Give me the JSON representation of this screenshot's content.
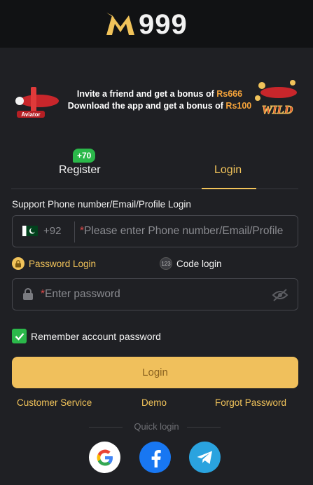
{
  "brand": {
    "logo_text": "999"
  },
  "promo": {
    "line1_prefix": "Invite a friend and get a bonus of ",
    "line1_amount": "Rs666",
    "line2_prefix": "Download the app and get a bonus of ",
    "line2_amount": "Rs100"
  },
  "tabs": {
    "register": "Register",
    "register_badge": "+70",
    "login": "Login",
    "active": "login"
  },
  "form": {
    "support_label": "Support Phone number/Email/Profile Login",
    "country_code": "+92",
    "phone_placeholder": "Please enter Phone number/Email/Profile",
    "password_login": "Password Login",
    "code_login": "Code login",
    "code_icon": "123",
    "password_placeholder": "Enter password",
    "required_mark": "*",
    "remember_label": "Remember account password",
    "remember_checked": true,
    "login_button": "Login"
  },
  "links": {
    "customer_service": "Customer Service",
    "demo": "Demo",
    "forgot_password": "Forgot Password"
  },
  "quick_login": {
    "label": "Quick login",
    "providers": [
      "google-icon",
      "facebook-icon",
      "telegram-icon"
    ]
  },
  "colors": {
    "accent": "#f1c35a",
    "background": "#1f2024",
    "success": "#2bb84a",
    "button": "#f0c05c"
  }
}
